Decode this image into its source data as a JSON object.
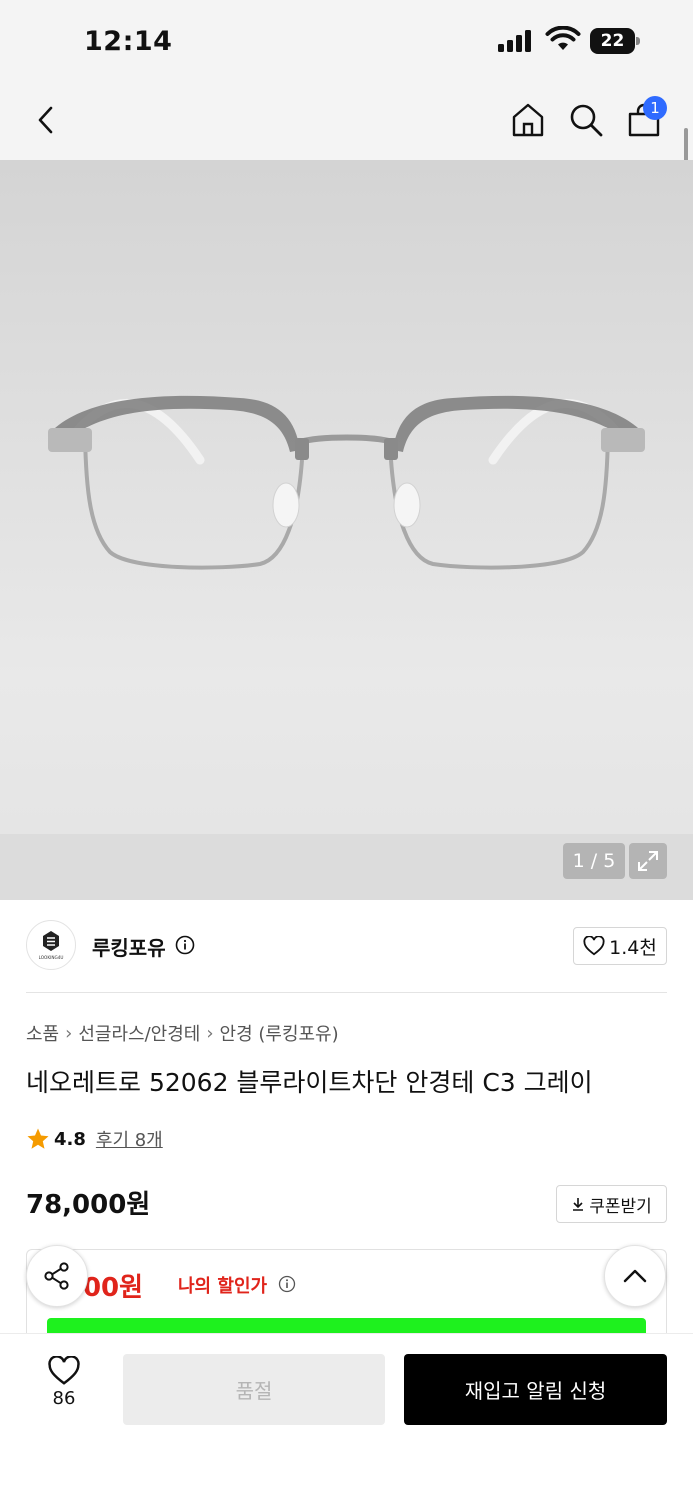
{
  "status_bar": {
    "time": "12:14",
    "battery": "22"
  },
  "nav": {
    "cart_count": "1"
  },
  "gallery": {
    "counter": "1 / 5"
  },
  "brand": {
    "name": "루킹포유",
    "logo_text": "LOOKING4U",
    "like_count": "1.4천"
  },
  "breadcrumb": [
    "소품",
    "선글라스/안경테",
    "안경 (루킹포유)"
  ],
  "product": {
    "title": "네오레트로 52062 블루라이트차단 안경테 C3 그레이",
    "rating": "4.8",
    "review_label": "후기 8개",
    "price": "78,000원",
    "coupon_label": "쿠폰받기",
    "my_price": ",900원",
    "my_price_label": "나의 할인가"
  },
  "bottom_bar": {
    "wish_count": "86",
    "soldout_label": "품절",
    "restock_label": "재입고 알림 신청"
  },
  "colors": {
    "accent_blue": "#2f6bff",
    "price_red": "#e0241b",
    "star": "#f59b00",
    "green_bar": "#1ef11e"
  }
}
